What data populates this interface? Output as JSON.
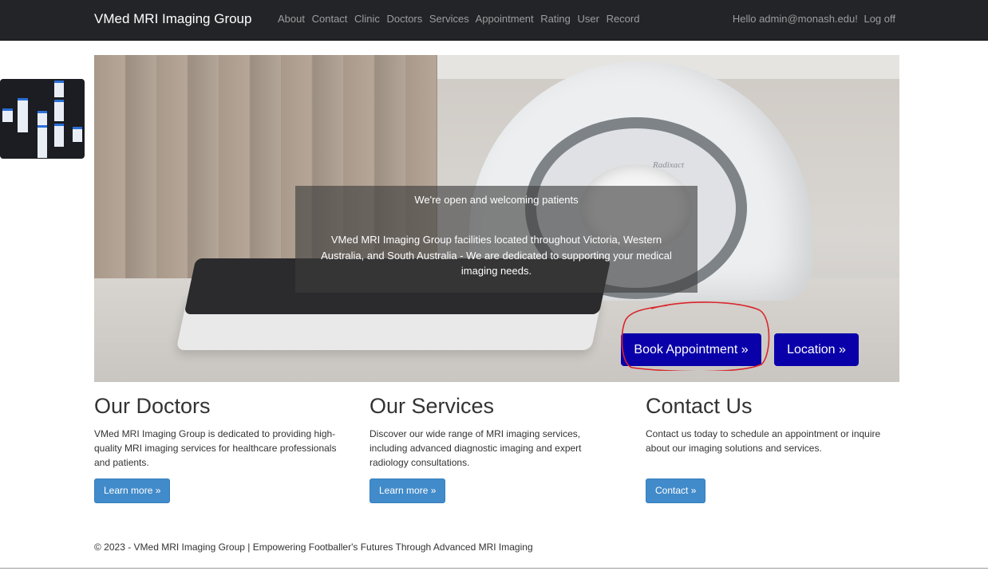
{
  "navbar": {
    "brand": "VMed MRI Imaging Group",
    "links": [
      "About",
      "Contact",
      "Clinic",
      "Doctors",
      "Services",
      "Appointment",
      "Rating",
      "User",
      "Record"
    ],
    "greeting": "Hello admin@monash.edu!",
    "logoff": "Log off"
  },
  "hero": {
    "scanner_label": "Radixact",
    "caption_title": "We're open and welcoming patients",
    "caption_text": "VMed MRI Imaging Group facilities located throughout Victoria, Western Australia, and South Australia - We are dedicated to supporting your medical imaging needs.",
    "book_button": "Book Appointment »",
    "location_button": "Location »",
    "annotation_color": "#d9262c"
  },
  "columns": [
    {
      "heading": "Our Doctors",
      "text": "VMed MRI Imaging Group is dedicated to providing high-quality MRI imaging services for healthcare professionals and patients.",
      "button": "Learn more »"
    },
    {
      "heading": "Our Services",
      "text": "Discover our wide range of MRI imaging services, including advanced diagnostic imaging and expert radiology consultations.",
      "button": "Learn more »"
    },
    {
      "heading": "Contact Us",
      "text": "Contact us today to schedule an appointment or inquire about our imaging solutions and services.",
      "button": "Contact »"
    }
  ],
  "footer": {
    "text": "© 2023 - VMed MRI Imaging Group | Empowering Footballer's Futures Through Advanced MRI Imaging"
  },
  "colors": {
    "navbar_bg": "#222428",
    "hero_button": "#0a00aa",
    "primary_button": "#428bca"
  }
}
